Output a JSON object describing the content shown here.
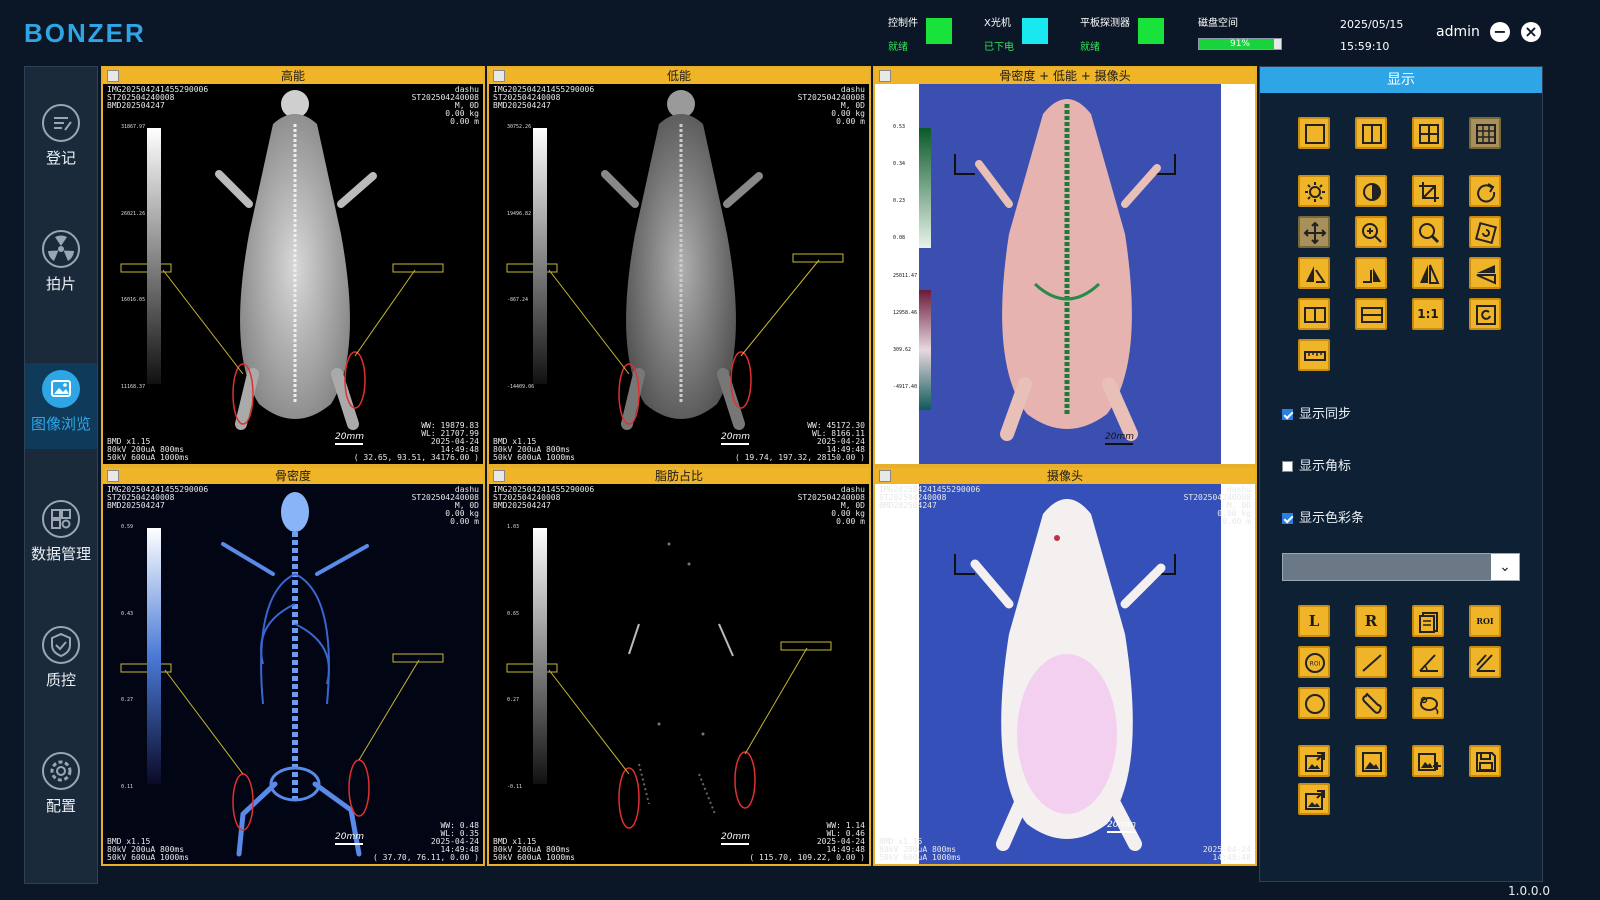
{
  "app": {
    "logo": "BONZER",
    "version": "1.0.0.0"
  },
  "header": {
    "statuses": [
      {
        "label": "控制件",
        "value": "就绪",
        "color": "#19e23a"
      },
      {
        "label": "X光机",
        "value": "已下电",
        "color": "#19e8f0"
      },
      {
        "label": "平板探测器",
        "value": "就绪",
        "color": "#19e23a"
      }
    ],
    "disk": {
      "label": "磁盘空间",
      "percent": 91,
      "text": "91%"
    },
    "date": "2025/05/15",
    "time": "15:59:10",
    "user": "admin",
    "minimize_icon": "minus-icon",
    "close_icon": "close-icon"
  },
  "sidebar": {
    "items": [
      {
        "label": "登记",
        "icon": "register-icon",
        "active": false
      },
      {
        "label": "拍片",
        "icon": "radiation-icon",
        "active": false
      },
      {
        "label": "图像浏览",
        "icon": "image-icon",
        "active": true
      },
      {
        "label": "数据管理",
        "icon": "data-manage-icon",
        "active": false
      },
      {
        "label": "质控",
        "icon": "shield-check-icon",
        "active": false
      },
      {
        "label": "配置",
        "icon": "gear-icon",
        "active": false
      }
    ]
  },
  "panes": [
    {
      "title": "高能",
      "tl": [
        "IMG20250424145529000​6",
        "ST20250424000​8",
        "BMD202504247"
      ],
      "tr": [
        "dashu",
        "ST202504240008",
        "M, 0D",
        "0.00 kg",
        "0.00 m"
      ],
      "bl": [
        "BMD x1.15",
        "80kV 200uA 800ms",
        "50kV 600uA 1000ms"
      ],
      "br": [
        "WW: 19879.83",
        "WL: 21707.99",
        "2025-04-24",
        "14:49:48",
        "( 32.65, 93.51, 34176.00 )"
      ],
      "scale": "20mm",
      "scale_ticks": [
        "31867.97",
        "26021.26",
        "16016.05",
        "11168.37"
      ]
    },
    {
      "title": "低能",
      "tl": [
        "IMG20250424145529000​6",
        "ST20250424000​8",
        "BMD202504247"
      ],
      "tr": [
        "dashu",
        "ST202504240008",
        "M, 0D",
        "0.00 kg",
        "0.00 m"
      ],
      "bl": [
        "BMD x1.15",
        "80kV 200uA 800ms",
        "50kV 600uA 1000ms"
      ],
      "br": [
        "WW: 45172.30",
        "WL: 8166.11",
        "2025-04-24",
        "14:49:48",
        "( 19.74, 197.32, 28150.00 )"
      ],
      "scale": "20mm",
      "scale_ticks": [
        "30752.26",
        "19496.82",
        "-867.24",
        "-14409.06"
      ]
    },
    {
      "title": "骨密度 + 低能 + 摄像头",
      "tl": [],
      "tr": [],
      "bl": [],
      "br": [],
      "scale": "20mm",
      "scale_ticks": [
        "0.53",
        "0.34",
        "0.23",
        "0.08",
        "25011.47",
        "12958.46",
        "309.62",
        "-4917.40"
      ]
    },
    {
      "title": "骨密度",
      "tl": [
        "IMG20250424145529000​6",
        "ST20250424000​8",
        "BMD202504247"
      ],
      "tr": [
        "dashu",
        "ST202504240008",
        "M, 0D",
        "0.00 kg",
        "0.00 m"
      ],
      "bl": [
        "BMD x1.15",
        "80kV 200uA 800ms",
        "50kV 600uA 1000ms"
      ],
      "br": [
        "WW: 0.48",
        "WL: 0.35",
        "2025-04-24",
        "14:49:48",
        "( 37.70, 76.11, 0.00 )"
      ],
      "scale": "20mm",
      "scale_ticks": [
        "0.59",
        "0.43",
        "0.27",
        "0.11"
      ]
    },
    {
      "title": "脂肪占比",
      "tl": [
        "IMG20250424145529000​6",
        "ST20250424000​8",
        "BMD202504247"
      ],
      "tr": [
        "dashu",
        "ST202504240008",
        "M, 0D",
        "0.00 kg",
        "0.00 m"
      ],
      "bl": [
        "BMD x1.15",
        "80kV 200uA 800ms",
        "50kV 600uA 1000ms"
      ],
      "br": [
        "WW: 1.14",
        "WL: 0.46",
        "2025-04-24",
        "14:49:48",
        "( 115.70, 109.22, 0.00 )"
      ],
      "scale": "20mm",
      "scale_ticks": [
        "1.03",
        "0.65",
        "0.27",
        "-0.11"
      ]
    },
    {
      "title": "摄像头",
      "tl": [
        "IMG20250424145529000​6",
        "ST20250424000​8",
        "BMD202504247"
      ],
      "tr": [
        "dashu",
        "ST202504240008",
        "M, 0D",
        "0.00 kg",
        "0.00 m"
      ],
      "bl": [
        "BMD x1.15",
        "80kV 200uA 800ms",
        "50kV 600uA 1000ms"
      ],
      "br": [
        "2025-04-24",
        "14:49:48"
      ],
      "scale": "20mm",
      "scale_ticks": []
    }
  ],
  "panel": {
    "title": "显示",
    "layout_tools": [
      "layout-1x1-icon",
      "layout-1x2-icon",
      "layout-2x2-icon",
      "layout-3x3-icon"
    ],
    "image_tools": [
      "brightness-icon",
      "contrast-icon",
      "crop-icon",
      "rotate-icon",
      "pan-icon",
      "zoom-in-icon",
      "magnifier-icon",
      "rotate-free-icon",
      "flip-left-icon",
      "flip-right-icon",
      "mirror-vertical-icon",
      "mirror-horizontal-icon",
      "fit-width-icon",
      "fit-height-icon",
      "actual-size-icon",
      "reset-view-icon",
      "ruler-icon"
    ],
    "actual_size_label": "1:1",
    "checks": [
      {
        "label": "显示同步",
        "checked": true
      },
      {
        "label": "显示角标",
        "checked": false
      },
      {
        "label": "显示色彩条",
        "checked": true
      }
    ],
    "select_value": "",
    "annotation_tools": [
      "label-left-icon",
      "label-right-icon",
      "notes-icon",
      "roi-rect-icon",
      "roi-circle-icon",
      "line-measure-icon",
      "angle-icon",
      "cobb-angle-icon",
      "ellipse-icon",
      "bone-icon",
      "mouse-roi-icon"
    ],
    "label_left": "L",
    "label_right": "R",
    "roi_label": "ROI",
    "export_tools": [
      "export-image-icon",
      "image-icon",
      "add-image-icon",
      "save-icon",
      "export-all-icon"
    ]
  }
}
